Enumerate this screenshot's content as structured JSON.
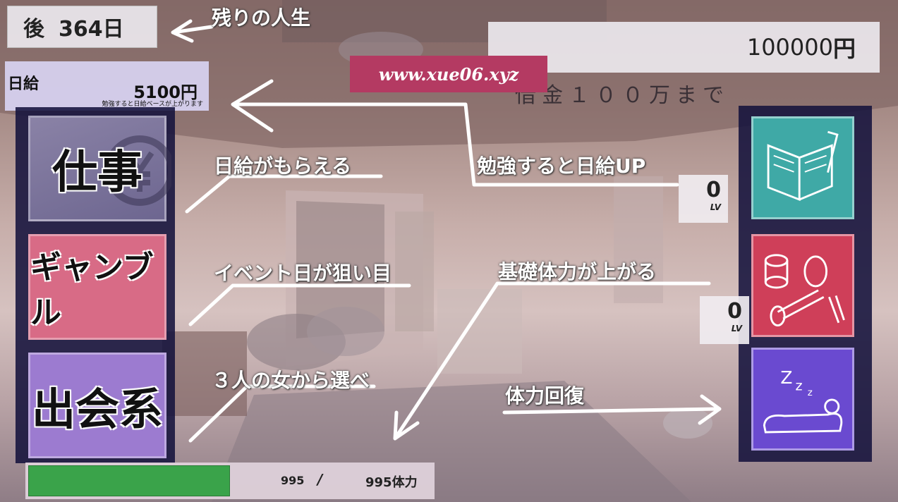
{
  "hud": {
    "days_prefix": "後",
    "days_value": "364日",
    "money_value": "100000",
    "money_unit": "円",
    "goal_text": "借金１００万まで",
    "wage_label": "日給",
    "wage_value": "5100円",
    "wage_note": "勉強すると日給ベースが上がります"
  },
  "watermark": "www.xue06.xyz",
  "left_menu": {
    "work_label": "仕事",
    "gamble_label": "ギャンブル",
    "dating_label": "出会系"
  },
  "right_menu": {
    "study_level": "0",
    "training_level": "0",
    "level_unit": "LV"
  },
  "stamina": {
    "current": "995",
    "separator": "/",
    "max_label": "995体力",
    "fill_fraction": 0.5
  },
  "tutorial": {
    "remaining_life": "残りの人生",
    "work_hint": "日給がもらえる",
    "gamble_hint": "イベント日が狙い目",
    "dating_hint": "３人の女から選べ",
    "study_hint": "勉強すると日給UP",
    "training_hint": "基礎体力が上がる",
    "sleep_hint": "体力回復"
  },
  "colors": {
    "study_button": "#3fa9a6",
    "training_button": "#cf3f59",
    "sleep_button": "#6a4ad0",
    "gamble_button": "#d86b86",
    "dating_button": "#9c7bd0",
    "stamina_bar": "#3aa34a",
    "watermark_bg": "#b43a62"
  }
}
